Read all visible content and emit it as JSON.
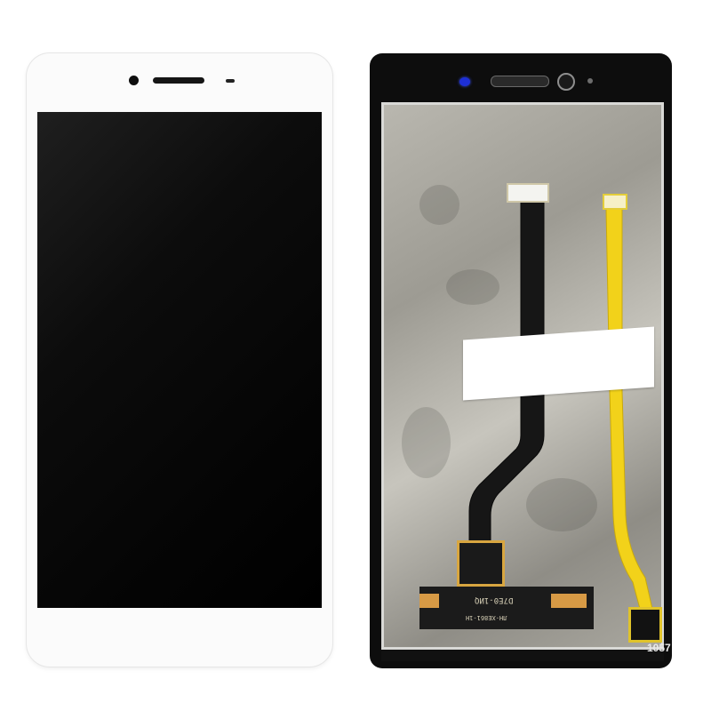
{
  "photo": {
    "back_marking_main": "D7E0-1ИQ",
    "back_marking_small": "ЛН-ХЕ861-1Н",
    "back_rev_code": "1057"
  },
  "colors": {
    "front_bezel": "#fbfbfb",
    "screen_black": "#050505",
    "back_frame": "#0d0d0d",
    "flex_yellow": "#f2d21a",
    "flex_black": "#161616",
    "front_led_blue": "#1d2fd6"
  }
}
